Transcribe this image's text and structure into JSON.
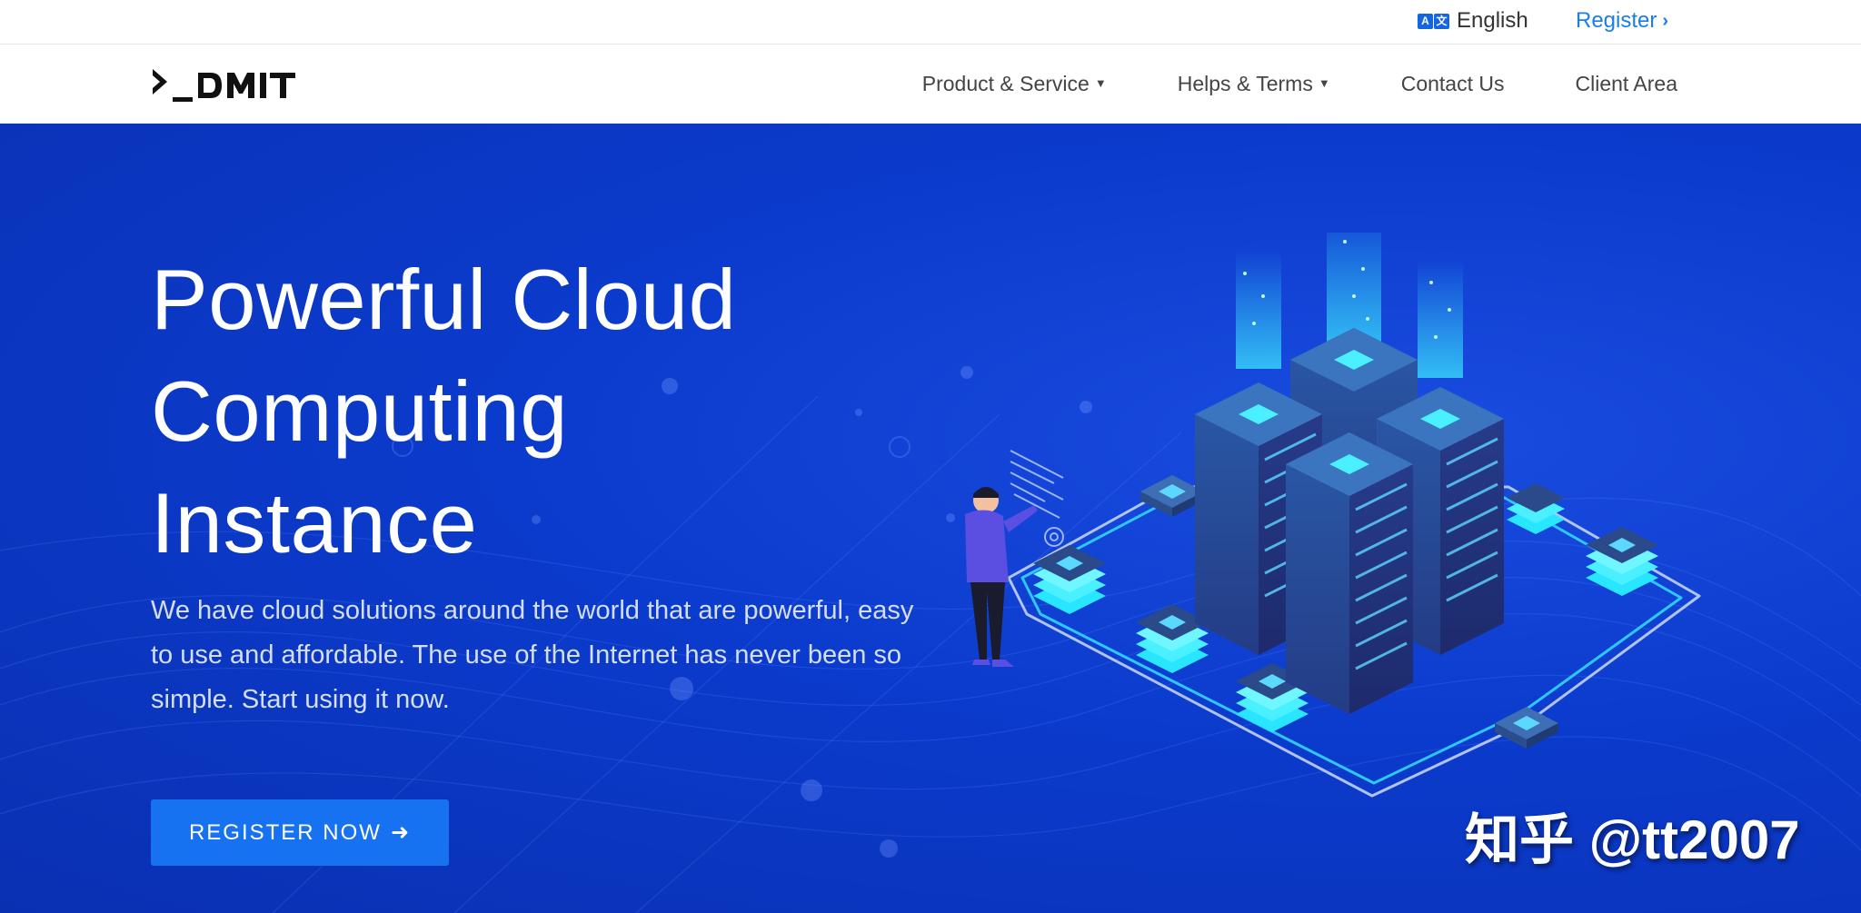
{
  "topbar": {
    "language_icon": "translate-icon",
    "language_icon_glyphs": [
      "A",
      "文"
    ],
    "language_label": "English",
    "register_label": "Register"
  },
  "navbar": {
    "logo_text": ">_DMIT",
    "items": [
      {
        "label": "Product & Service",
        "dropdown": true
      },
      {
        "label": "Helps & Terms",
        "dropdown": true
      },
      {
        "label": "Contact Us",
        "dropdown": false
      },
      {
        "label": "Client Area",
        "dropdown": false
      }
    ]
  },
  "hero": {
    "title_lines": [
      "Powerful Cloud",
      "Computing",
      "Instance"
    ],
    "subtitle": "We have cloud solutions around the world that are powerful, easy to use and affordable. The use of the Internet has never been so simple. Start using it now.",
    "cta_label": "REGISTER NOW",
    "cta_icon": "arrow-right-icon",
    "illustration": "isometric-datacenter-illustration"
  },
  "watermark": {
    "text": "知乎 @tt2007"
  },
  "colors": {
    "accent": "#1a7ee8",
    "hero_bg": "#0b3bcc",
    "cta_bg": "#1672f0",
    "server_glow": "#3ef0ff"
  }
}
